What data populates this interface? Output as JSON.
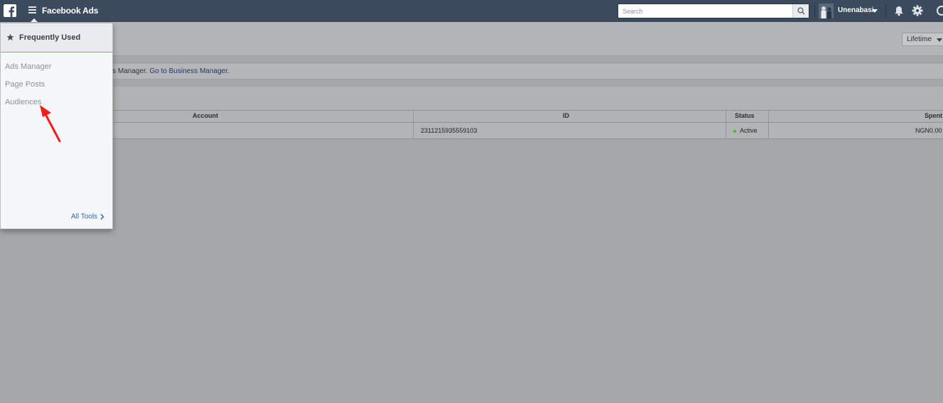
{
  "topbar": {
    "app_title": "Facebook Ads",
    "search_placeholder": "Search",
    "user_name": "Unenabasi"
  },
  "menu": {
    "header_label": "Frequently Used",
    "items": [
      {
        "label": "Ads Manager"
      },
      {
        "label": "Page Posts"
      },
      {
        "label": "Audiences"
      }
    ],
    "footer_label": "All Tools"
  },
  "page": {
    "date_range": "Lifetime",
    "notice_text_prefix": "ness Manager. ",
    "notice_link": "Go to Business Manager",
    "notice_text_suffix": "."
  },
  "table": {
    "columns": [
      "Account",
      "ID",
      "Status",
      "Spent"
    ],
    "rows": [
      {
        "account": "",
        "id": "2311215935559103",
        "status": "Active",
        "spent": "NGN0.00"
      }
    ]
  },
  "colors": {
    "topbar": "#3b4a5c",
    "menu_accent": "#6aa0ea",
    "link": "#2f66b8",
    "status_active": "#42b72a",
    "annotation_arrow": "#ff1a1a"
  },
  "icons": {
    "logo": "facebook-logo-icon",
    "menu": "hamburger-icon",
    "search": "search-icon",
    "notifications": "bell-icon",
    "settings": "gear-icon",
    "favorite": "star-icon",
    "more": "chevron-right-icon"
  }
}
